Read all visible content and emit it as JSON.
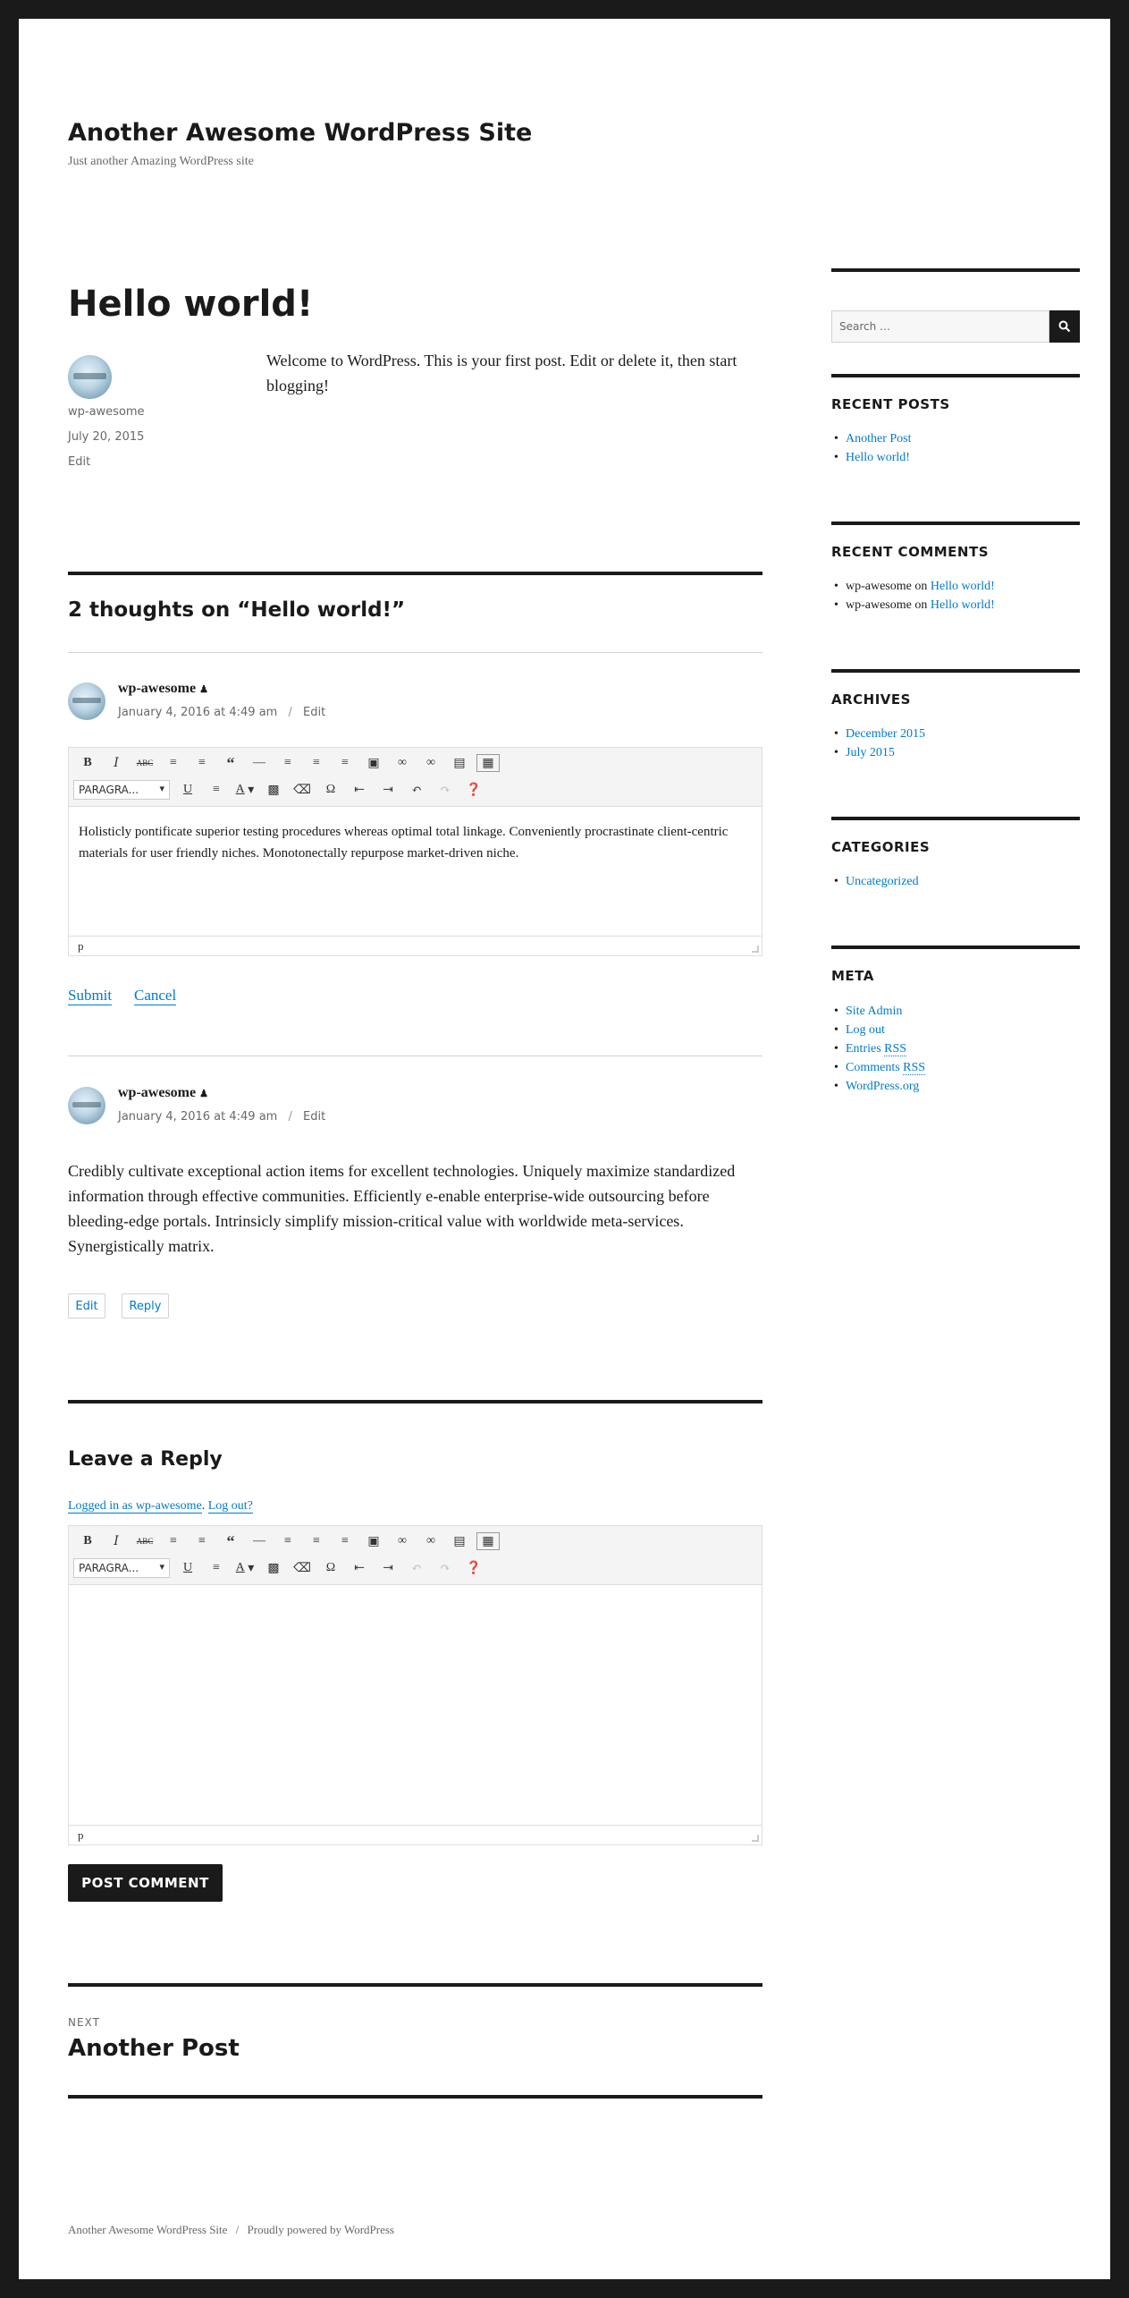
{
  "site": {
    "title": "Another Awesome WordPress Site",
    "description": "Just another Amazing WordPress site"
  },
  "post": {
    "title": "Hello world!",
    "author": "wp-awesome",
    "date": "July 20, 2015",
    "edit": "Edit",
    "body": "Welcome to WordPress. This is your first post. Edit or delete it, then start blogging!"
  },
  "comments": {
    "heading": "2 thoughts on “Hello world!”",
    "items": [
      {
        "author": "wp-awesome",
        "date": "January 4, 2016 at 4:49 am",
        "edit": "Edit",
        "editor_text": "Holisticly pontificate superior testing procedures whereas optimal total linkage. Conveniently procrastinate client-centric materials for user friendly niches. Monotonectally repurpose market-driven niche.",
        "status_path": "p",
        "submit": "Submit",
        "cancel": "Cancel"
      },
      {
        "author": "wp-awesome",
        "date": "January 4, 2016 at 4:49 am",
        "edit": "Edit",
        "body": "Credibly cultivate exceptional action items for excellent technologies. Uniquely maximize standardized information through effective communities. Efficiently e-enable enterprise-wide outsourcing before bleeding-edge portals. Intrinsicly simplify mission-critical value with worldwide meta-services. Synergistically matrix.",
        "edit_button": "Edit",
        "reply_button": "Reply"
      }
    ]
  },
  "toolbar": {
    "format_select": "PARAGRA...",
    "row1_icons": [
      "bold-icon",
      "italic-icon",
      "strikethrough-icon",
      "bullet-list-icon",
      "numbered-list-icon",
      "blockquote-icon",
      "horizontal-rule-icon",
      "align-left-icon",
      "align-center-icon",
      "align-right-icon",
      "image-icon",
      "link-icon",
      "unlink-icon",
      "read-more-icon",
      "toolbar-toggle-icon"
    ],
    "row2_icons": [
      "underline-icon",
      "justify-icon",
      "text-color-icon",
      "paste-text-icon",
      "clear-formatting-icon",
      "special-character-icon",
      "outdent-icon",
      "indent-icon",
      "undo-icon",
      "redo-icon",
      "help-icon"
    ]
  },
  "reply_form": {
    "heading": "Leave a Reply",
    "logged_in_text": "Logged in as wp-awesome",
    "logout_text": "Log out?",
    "status_path": "p",
    "submit": "POST COMMENT"
  },
  "post_nav": {
    "label": "NEXT",
    "title": "Another Post"
  },
  "sidebar": {
    "search_placeholder": "Search …",
    "recent_posts": {
      "title": "RECENT POSTS",
      "items": [
        "Another Post",
        "Hello world!"
      ]
    },
    "recent_comments": {
      "title": "RECENT COMMENTS",
      "items": [
        {
          "author": "wp-awesome",
          "on": "on",
          "post": "Hello world!"
        },
        {
          "author": "wp-awesome",
          "on": "on",
          "post": "Hello world!"
        }
      ]
    },
    "archives": {
      "title": "ARCHIVES",
      "items": [
        "December 2015",
        "July 2015"
      ]
    },
    "categories": {
      "title": "CATEGORIES",
      "items": [
        "Uncategorized"
      ]
    },
    "meta": {
      "title": "META",
      "items": [
        {
          "text": "Site Admin"
        },
        {
          "text": "Log out"
        },
        {
          "text": "Entries ",
          "abbr": "RSS"
        },
        {
          "text": "Comments ",
          "abbr": "RSS"
        },
        {
          "text": "WordPress.org"
        }
      ]
    }
  },
  "footer": {
    "site": "Another Awesome WordPress Site",
    "sep": "/",
    "powered": "Proudly powered by WordPress"
  }
}
